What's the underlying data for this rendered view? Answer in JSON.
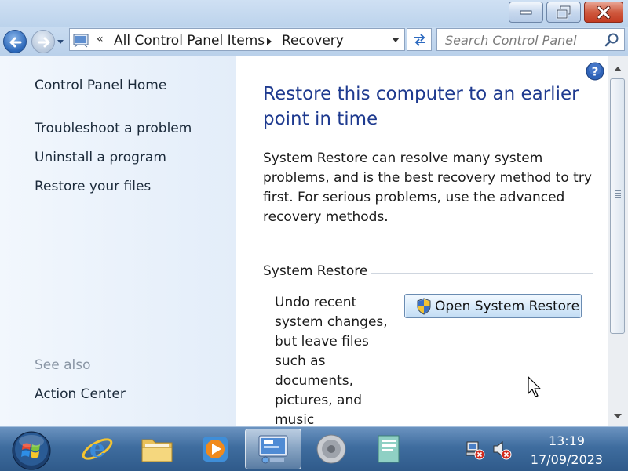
{
  "window": {
    "caption_buttons": [
      "minimize",
      "restore",
      "close"
    ]
  },
  "address": {
    "crumbs": [
      "All Control Panel Items",
      "Recovery"
    ],
    "chevron": "«",
    "search_placeholder": "Search Control Panel"
  },
  "sidebar": {
    "home": "Control Panel Home",
    "links": [
      "Troubleshoot a problem",
      "Uninstall a program",
      "Restore your files"
    ],
    "see_also_label": "See also",
    "see_also_links": [
      "Action Center"
    ]
  },
  "main": {
    "heading": "Restore this computer to an earlier point in time",
    "description": "System Restore can resolve many system problems, and is the best recovery method to try first. For serious problems, use the advanced recovery methods.",
    "section_title": "System Restore",
    "section_description": "Undo recent system changes, but leave files such as documents, pictures, and music",
    "button_label": "Open System Restore"
  },
  "taskbar": {
    "apps": [
      "internet-explorer",
      "windows-explorer",
      "media-player",
      "control-panel",
      "volume-mixer",
      "document"
    ],
    "active_app": "control-panel",
    "time": "13:19",
    "date": "17/09/2023"
  },
  "colors": {
    "heading": "#1e3a8f",
    "sidebar_bg": "#e8f0fa",
    "taskbar": "#3f6d9f"
  }
}
